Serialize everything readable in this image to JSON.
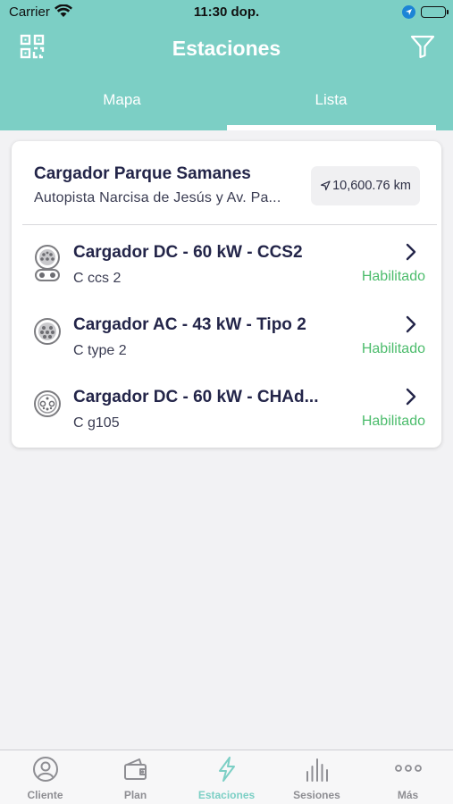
{
  "status_bar": {
    "carrier": "Carrier",
    "time": "11:30 dop."
  },
  "header": {
    "title": "Estaciones",
    "qr_icon": "qr-code-icon",
    "filter_icon": "filter-icon"
  },
  "tabs": [
    {
      "label": "Mapa",
      "active": false
    },
    {
      "label": "Lista",
      "active": true
    }
  ],
  "station": {
    "name": "Cargador Parque Samanes",
    "address": "Autopista Narcisa de Jesús y Av. Pa...",
    "distance": "10,600.76 km",
    "distance_icon": "navigation-arrow-icon",
    "chargers": [
      {
        "name": "Cargador DC - 60 kW - CCS2",
        "code": "C ccs 2",
        "status": "Habilitado",
        "icon": "ccs2-connector-icon"
      },
      {
        "name": "Cargador AC - 43 kW - Tipo 2",
        "code": "C type 2",
        "status": "Habilitado",
        "icon": "type2-connector-icon"
      },
      {
        "name": "Cargador DC - 60 kW - CHAd...",
        "code": "C g105",
        "status": "Habilitado",
        "icon": "chademo-connector-icon"
      }
    ]
  },
  "tab_bar": [
    {
      "label": "Cliente",
      "icon": "user-icon",
      "active": false
    },
    {
      "label": "Plan",
      "icon": "wallet-icon",
      "active": false
    },
    {
      "label": "Estaciones",
      "icon": "lightning-icon",
      "active": true
    },
    {
      "label": "Sesiones",
      "icon": "bars-icon",
      "active": false
    },
    {
      "label": "Más",
      "icon": "more-icon",
      "active": false
    }
  ],
  "colors": {
    "accent": "#7ccfc5",
    "status_green": "#4cbc6c",
    "title_text": "#232549"
  }
}
